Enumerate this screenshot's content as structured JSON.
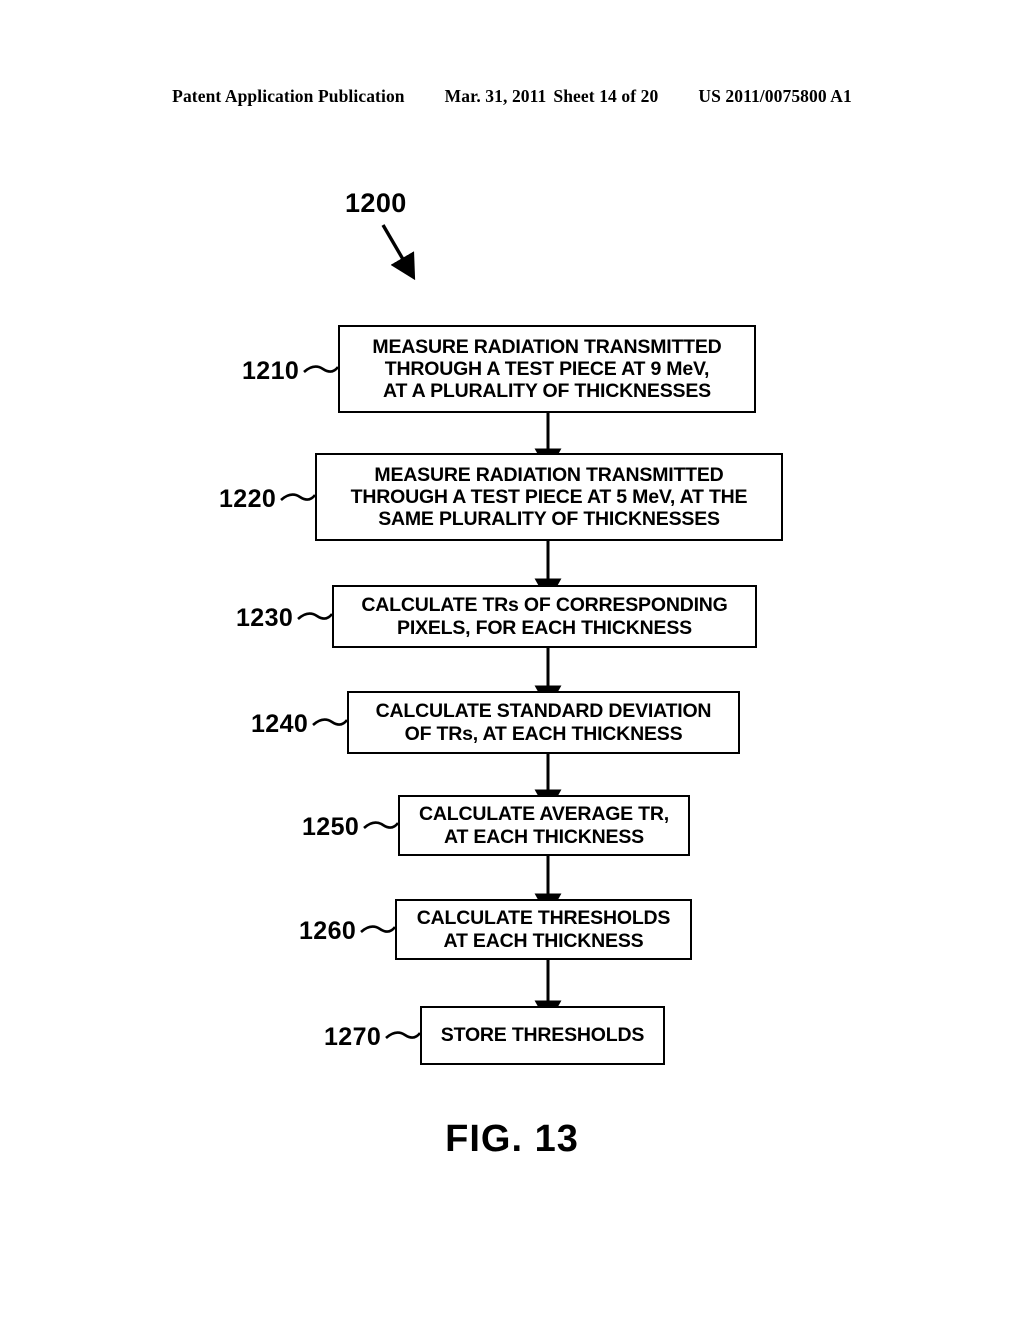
{
  "header": {
    "publication": "Patent Application Publication",
    "date": "Mar. 31, 2011",
    "sheet": "Sheet 14 of 20",
    "patent_number": "US 2011/0075800 A1"
  },
  "figure": {
    "caption": "FIG. 13",
    "diagram_label": "1200"
  },
  "flowchart": {
    "type": "flowchart",
    "orientation": "vertical",
    "steps": [
      {
        "ref": "1210",
        "lines": [
          "MEASURE RADIATION TRANSMITTED",
          "THROUGH A TEST PIECE AT 9 MeV,",
          "AT A PLURALITY OF THICKNESSES"
        ]
      },
      {
        "ref": "1220",
        "lines": [
          "MEASURE RADIATION TRANSMITTED",
          "THROUGH A TEST PIECE AT 5 MeV, AT THE",
          "SAME PLURALITY OF THICKNESSES"
        ]
      },
      {
        "ref": "1230",
        "lines": [
          "CALCULATE TRs OF CORRESPONDING",
          "PIXELS, FOR EACH THICKNESS"
        ]
      },
      {
        "ref": "1240",
        "lines": [
          "CALCULATE STANDARD DEVIATION",
          "OF TRs, AT EACH THICKNESS"
        ]
      },
      {
        "ref": "1250",
        "lines": [
          "CALCULATE AVERAGE TR,",
          "AT EACH THICKNESS"
        ]
      },
      {
        "ref": "1260",
        "lines": [
          "CALCULATE THRESHOLDS",
          "AT EACH THICKNESS"
        ]
      },
      {
        "ref": "1270",
        "lines": [
          "STORE THRESHOLDS"
        ]
      }
    ]
  },
  "colors": {
    "ink": "#000000",
    "paper": "#ffffff"
  }
}
